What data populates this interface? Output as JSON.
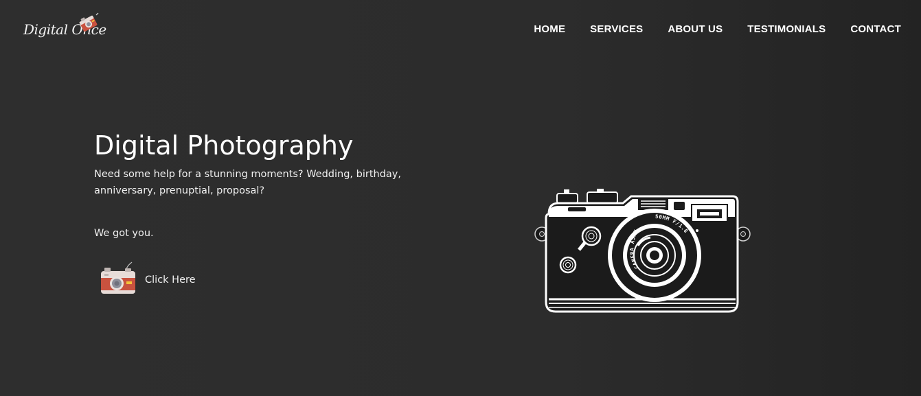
{
  "brand": {
    "logo_text": "Digital Once",
    "logo_icon": "camera-icon"
  },
  "nav": {
    "items": [
      {
        "label": "HOME"
      },
      {
        "label": "SERVICES"
      },
      {
        "label": "ABOUT US"
      },
      {
        "label": "TESTIMONIALS"
      },
      {
        "label": "CONTACT"
      }
    ]
  },
  "hero": {
    "title": "Digital Photography",
    "description": "Need some help for a stunning moments? Wedding, birthday, anniversary, prenuptial, proposal?",
    "tagline": "We got you.",
    "cta_label": "Click Here",
    "cta_icon": "camera-icon",
    "illustration": "vintage-camera-illustration",
    "lens_text": "CAMERA ASPHERICAL LENS",
    "lens_spec": "50MM F/1.8"
  },
  "colors": {
    "background": "#2d2d2d",
    "text": "#ffffff",
    "cta_camera_body": "#c9523f",
    "cta_camera_top": "#e7dcd8"
  }
}
